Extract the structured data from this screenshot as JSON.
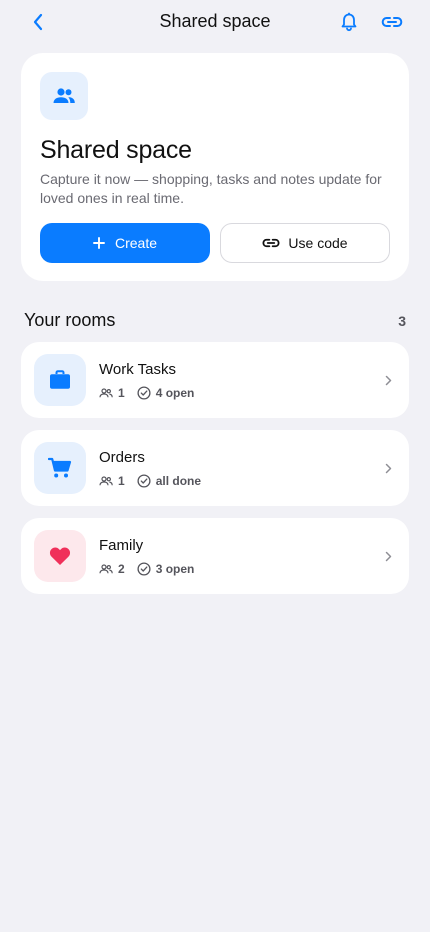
{
  "header": {
    "title": "Shared space",
    "back_icon": "chevron-left-icon",
    "bell_icon": "bell-icon",
    "link_icon": "link-icon",
    "accent": "#0a7cff"
  },
  "hero": {
    "icon": "people-icon",
    "title": "Shared space",
    "description": "Capture it now — shopping, tasks and notes update for loved ones in real time.",
    "create_label": "Create",
    "use_code_label": "Use code"
  },
  "rooms_section": {
    "title": "Your rooms",
    "count": "3"
  },
  "rooms": [
    {
      "name": "Work Tasks",
      "members": "1",
      "status": "4 open",
      "icon": "briefcase-icon",
      "icon_color": "#0a7cff",
      "icon_bg": "#e6f0fd"
    },
    {
      "name": "Orders",
      "members": "1",
      "status": "all done",
      "icon": "cart-icon",
      "icon_color": "#0a7cff",
      "icon_bg": "#e6f0fd"
    },
    {
      "name": "Family",
      "members": "2",
      "status": "3 open",
      "icon": "heart-icon",
      "icon_color": "#f0305a",
      "icon_bg": "#fde8ec"
    }
  ]
}
